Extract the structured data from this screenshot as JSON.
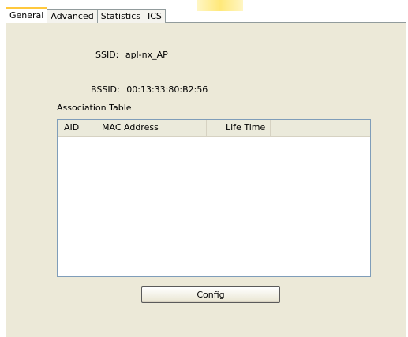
{
  "tabs": [
    {
      "label": "General",
      "active": true
    },
    {
      "label": "Advanced",
      "active": false
    },
    {
      "label": "Statistics",
      "active": false
    },
    {
      "label": "ICS",
      "active": false
    }
  ],
  "general": {
    "ssid_label": "SSID:",
    "ssid_value": "apl-nx_AP",
    "bssid_label": "BSSID:",
    "bssid_value": "00:13:33:80:B2:56",
    "association_table_label": "Association Table",
    "columns": [
      "AID",
      "MAC Address",
      "Life Time"
    ],
    "rows": [],
    "config_button": "Config"
  },
  "colors": {
    "panel_bg": "#ece9d8",
    "active_tab_accent": "#ffc83c",
    "list_border": "#7f9db9"
  }
}
